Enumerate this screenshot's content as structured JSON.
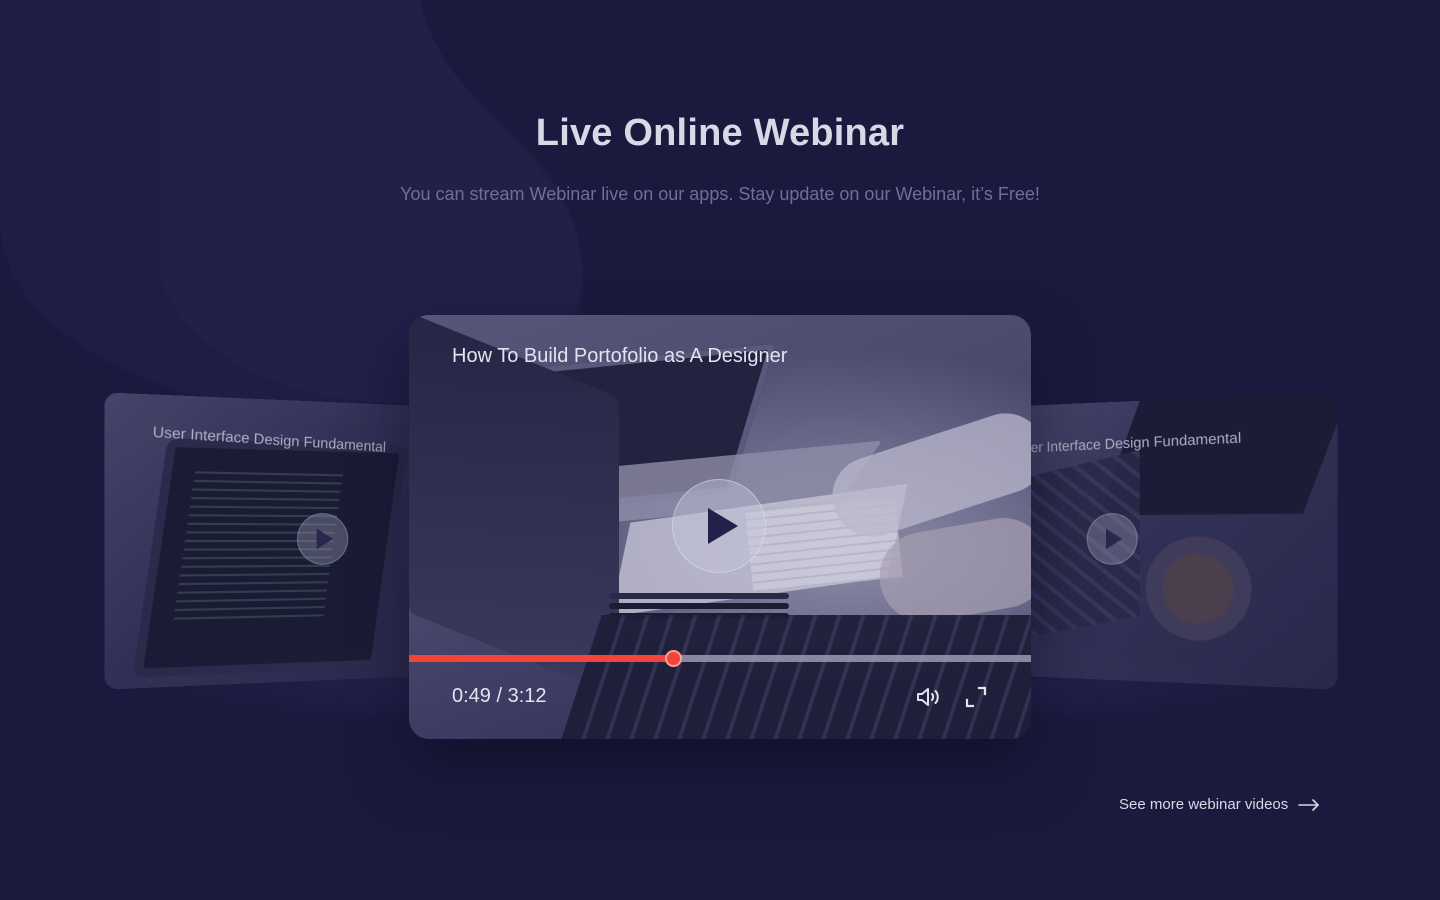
{
  "section": {
    "title": "Live Online Webinar",
    "subtitle": "You can stream Webinar live on our apps. Stay update on our Webinar, it’s Free!"
  },
  "carousel": {
    "left_card": {
      "title": "User Interface Design Fundamental",
      "play_icon": "play-icon"
    },
    "right_card": {
      "title": "User Interface Design Fundamental",
      "play_icon": "play-icon"
    },
    "main_player": {
      "title": "How To Build Portofolio as A Designer",
      "current_time": "0:49",
      "duration": "3:12",
      "time_display": "0:49 / 3:12",
      "progress_fraction": 0.425,
      "play_icon": "play-icon",
      "volume_icon": "volume-icon",
      "fullscreen_icon": "fullscreen-icon"
    }
  },
  "footer_link": {
    "label": "See more webinar videos",
    "icon": "arrow-right-icon"
  },
  "colors": {
    "background": "#1a1a3e",
    "progress_accent": "#f2443a",
    "title_text": "#d8d8e6",
    "subtitle_text": "#6f6f96"
  }
}
